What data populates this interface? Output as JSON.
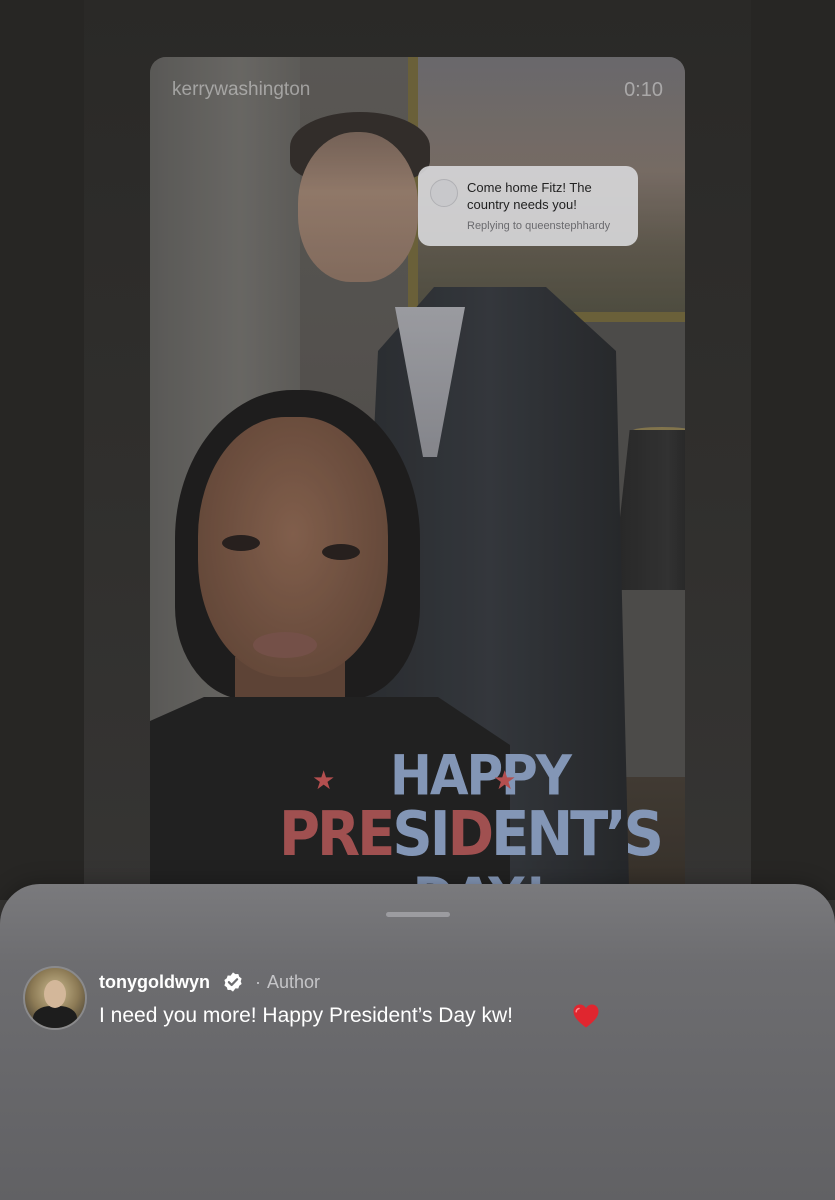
{
  "story": {
    "username": "kerrywashington",
    "time": "0:10",
    "reply_sticker": {
      "text": "Come home Fitz! The country needs you!",
      "replying_to": "Replying to queenstephhardy"
    },
    "overlay": {
      "line1": "HAPPY",
      "line2_red_a": "PRE",
      "line2_blue_a": "SI",
      "line2_red_b": "D",
      "line2_blue_b": "ENT’S",
      "line3": "DAY!",
      "star_glyph": "★"
    }
  },
  "comment": {
    "username": "tonygoldwyn",
    "separator": "·",
    "badge": "Author",
    "text": "I need you more! Happy President’s Day kw!",
    "verified_icon": "verified-badge-icon",
    "emoji_icon": "red-heart-icon"
  },
  "colors": {
    "background": "#2d2c2a",
    "sheet": "#6d6d70",
    "heart": "#e0262f",
    "overlay_blue": "#8396b6",
    "overlay_red": "#a05050"
  }
}
